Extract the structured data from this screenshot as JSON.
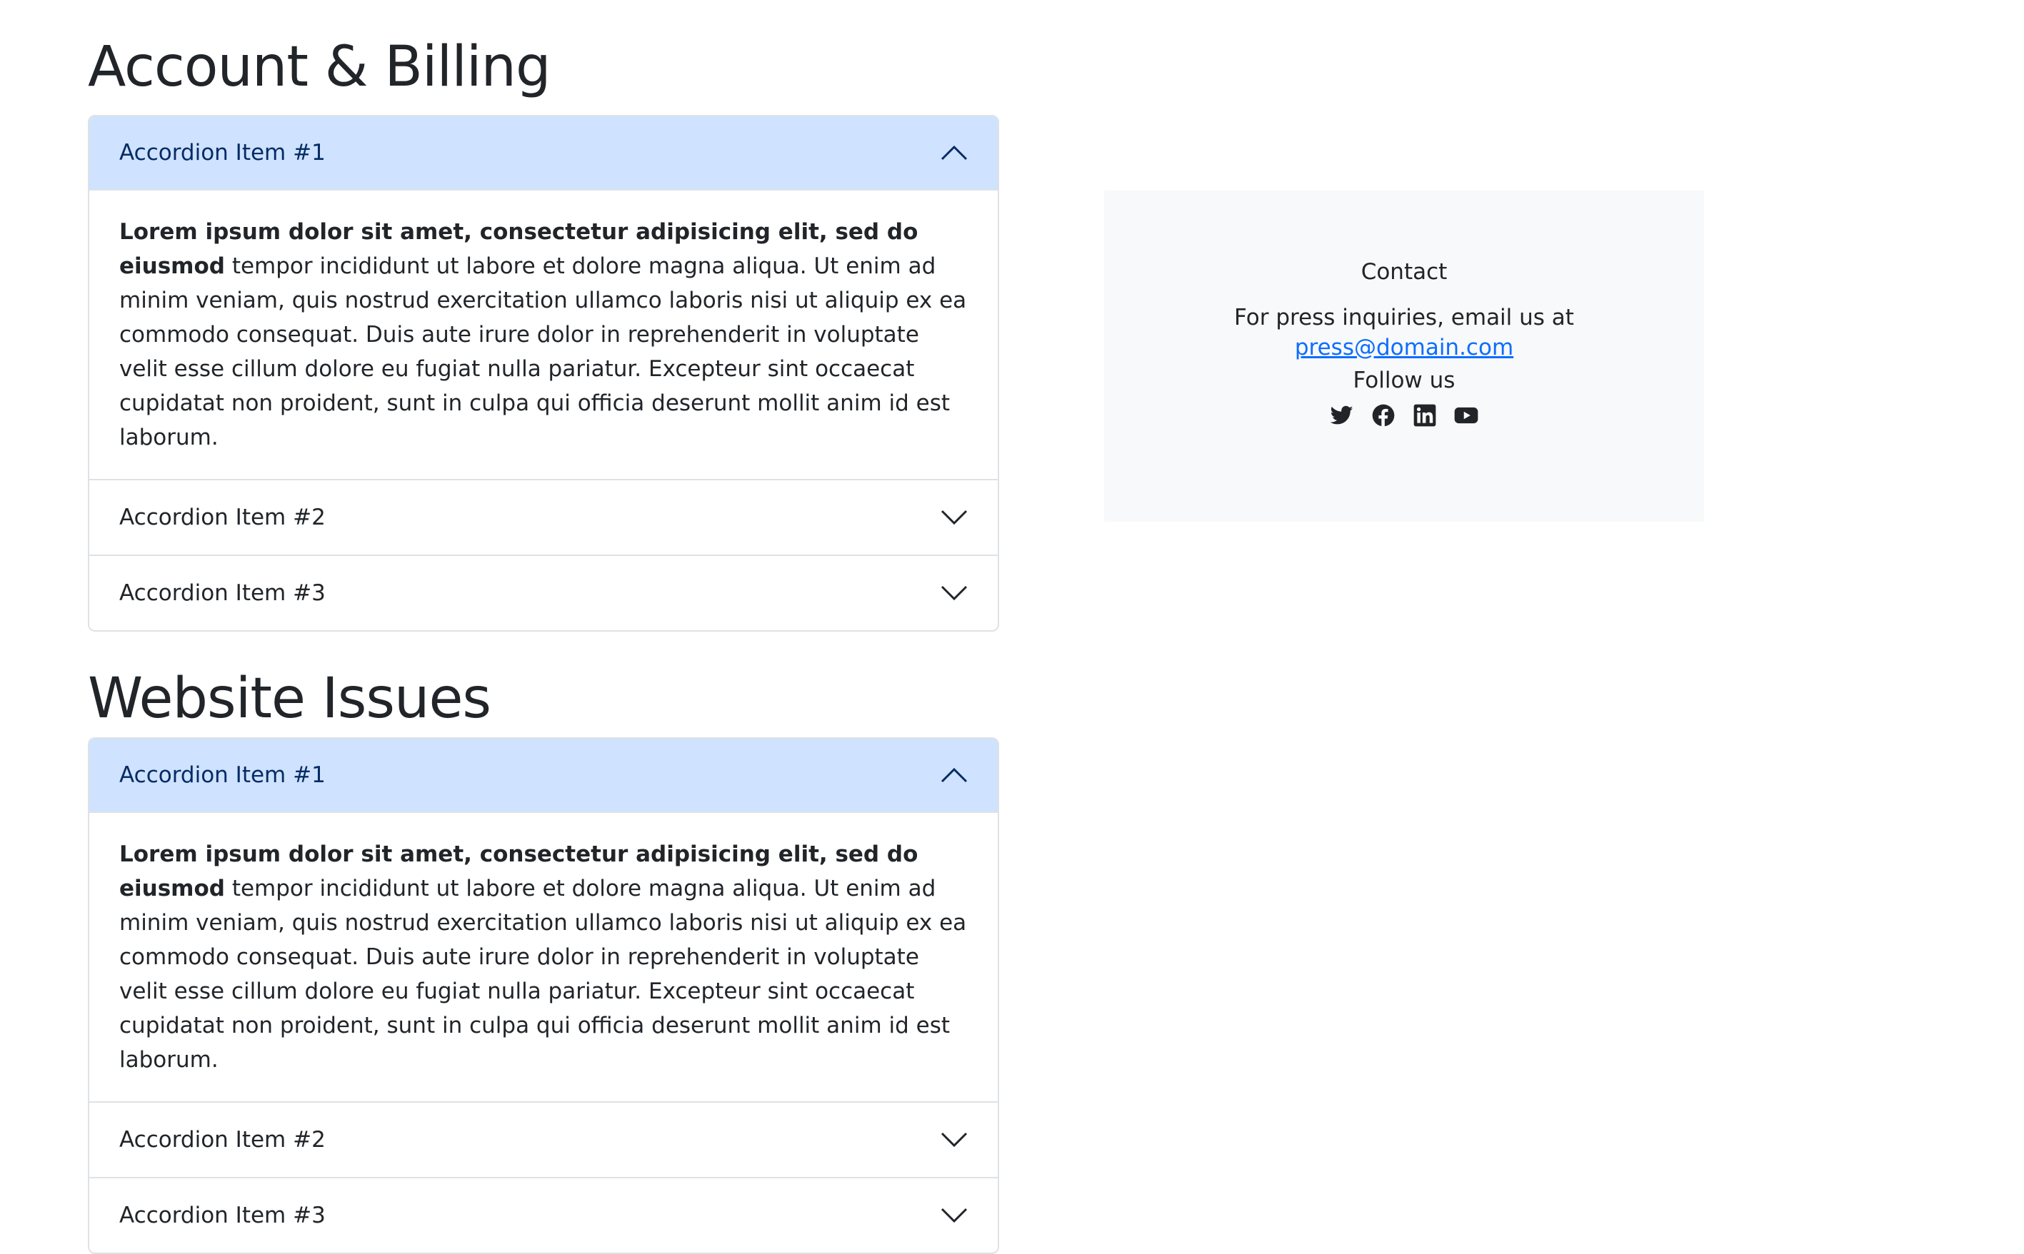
{
  "sections": [
    {
      "title": "Account & Billing",
      "items": [
        {
          "label": "Accordion Item #1",
          "body_bold": "Lorem ipsum dolor sit amet, consectetur adipisicing elit, sed do eiusmod",
          "body_text": " tempor incididunt ut labore et dolore magna aliqua. Ut enim ad minim veniam, quis nostrud exercitation ullamco laboris nisi ut aliquip ex ea commodo consequat. Duis aute irure dolor in reprehenderit in voluptate velit esse cillum dolore eu fugiat nulla pariatur. Excepteur sint occaecat cupidatat non proident, sunt in culpa qui officia deserunt mollit anim id est laborum."
        },
        {
          "label": "Accordion Item #2"
        },
        {
          "label": "Accordion Item #3"
        }
      ]
    },
    {
      "title": "Website Issues",
      "items": [
        {
          "label": "Accordion Item #1",
          "body_bold": "Lorem ipsum dolor sit amet, consectetur adipisicing elit, sed do eiusmod",
          "body_text": " tempor incididunt ut labore et dolore magna aliqua. Ut enim ad minim veniam, quis nostrud exercitation ullamco laboris nisi ut aliquip ex ea commodo consequat. Duis aute irure dolor in reprehenderit in voluptate velit esse cillum dolore eu fugiat nulla pariatur. Excepteur sint occaecat cupidatat non proident, sunt in culpa qui officia deserunt mollit anim id est laborum."
        },
        {
          "label": "Accordion Item #2"
        },
        {
          "label": "Accordion Item #3"
        }
      ]
    }
  ],
  "contact": {
    "title": "Contact",
    "text": "For press inquiries, email us at",
    "email": "press@domain.com",
    "follow_title": "Follow us",
    "social_icons": [
      "twitter-icon",
      "facebook-icon",
      "linkedin-icon",
      "youtube-icon"
    ]
  },
  "colors": {
    "open_header_bg": "#cfe2ff",
    "open_header_text": "#052c65",
    "link": "#0d6efd",
    "card_bg": "#f8f9fa",
    "border": "#dee2e6"
  }
}
